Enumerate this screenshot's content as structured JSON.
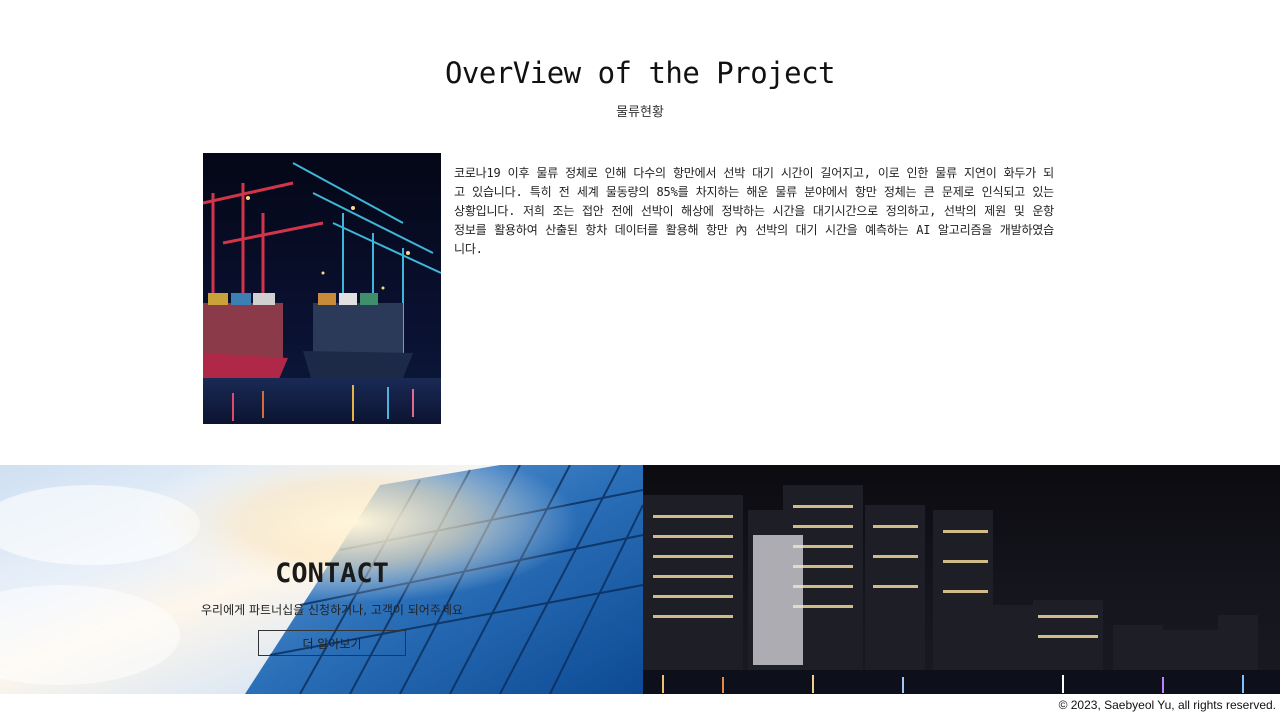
{
  "overview": {
    "title": "OverView of the Project",
    "subtitle": "물류현황",
    "body": "코로나19 이후 물류 정체로 인해 다수의 항만에서 선박 대기 시간이 길어지고, 이로 인한 물류 지연이 화두가 되고 있습니다. 특히 전 세계 물동량의 85%를 차지하는 해운 물류 분야에서 항만 정체는 큰 문제로 인식되고 있는 상황입니다. 저희 조는 접안 전에 선박이 해상에 정박하는 시간을 대기시간으로 정의하고, 선박의 제원 및 운항 정보를 활용하여 산출된 항차 데이터를 활용해 항만 內 선박의 대기 시간을 예측하는 AI 알고리즘을 개발하였습니다."
  },
  "contact": {
    "title": "CONTACT",
    "subtitle": "우리에게 파트너십을 신청하거나, 고객이 되어주세요",
    "button_label": "더 알아보기"
  },
  "footer": {
    "copyright": "© 2023,  Saebyeol Yu, all rights reserved."
  }
}
